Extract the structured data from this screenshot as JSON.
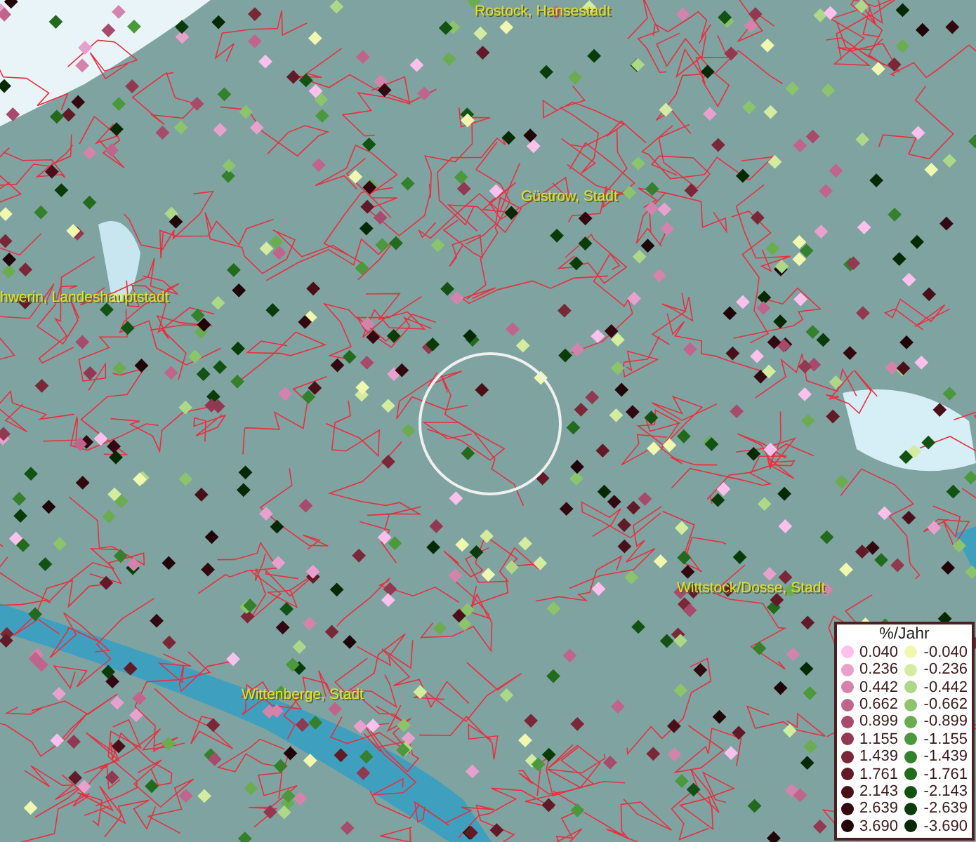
{
  "map": {
    "cities": [
      {
        "name": "Rostock, Hansestadt"
      },
      {
        "name": "Güstrow, Stadt"
      },
      {
        "name": "hwerin, Landeshauptstadt"
      },
      {
        "name": "Wittstock/Dosse, Stadt"
      },
      {
        "name": "Wittenberge, Stadt"
      }
    ]
  },
  "legend": {
    "title": "%/Jahr",
    "columns": [
      {
        "items": [
          {
            "value": "0.040",
            "color": "#ffc0ec"
          },
          {
            "value": "0.236",
            "color": "#e8a0cc"
          },
          {
            "value": "0.442",
            "color": "#d484ac"
          },
          {
            "value": "0.662",
            "color": "#c0648c"
          },
          {
            "value": "0.899",
            "color": "#a84a6c"
          },
          {
            "value": "1.155",
            "color": "#923850"
          },
          {
            "value": "1.439",
            "color": "#7a2838"
          },
          {
            "value": "1.761",
            "color": "#621a28"
          },
          {
            "value": "2.143",
            "color": "#4a101a"
          },
          {
            "value": "2.639",
            "color": "#340810"
          },
          {
            "value": "3.690",
            "color": "#200408"
          }
        ]
      },
      {
        "items": [
          {
            "value": "-0.040",
            "color": "#f0f8b0"
          },
          {
            "value": "-0.236",
            "color": "#d4eca0"
          },
          {
            "value": "-0.442",
            "color": "#acd888"
          },
          {
            "value": "-0.662",
            "color": "#8cc46c"
          },
          {
            "value": "-0.899",
            "color": "#6cac50"
          },
          {
            "value": "-1.155",
            "color": "#4c983c"
          },
          {
            "value": "-1.439",
            "color": "#34802c"
          },
          {
            "value": "-1.761",
            "color": "#226a1c"
          },
          {
            "value": "-2.143",
            "color": "#125212"
          },
          {
            "value": "-2.639",
            "color": "#0a3c0a"
          },
          {
            "value": "-3.690",
            "color": "#042a04"
          }
        ]
      }
    ]
  }
}
